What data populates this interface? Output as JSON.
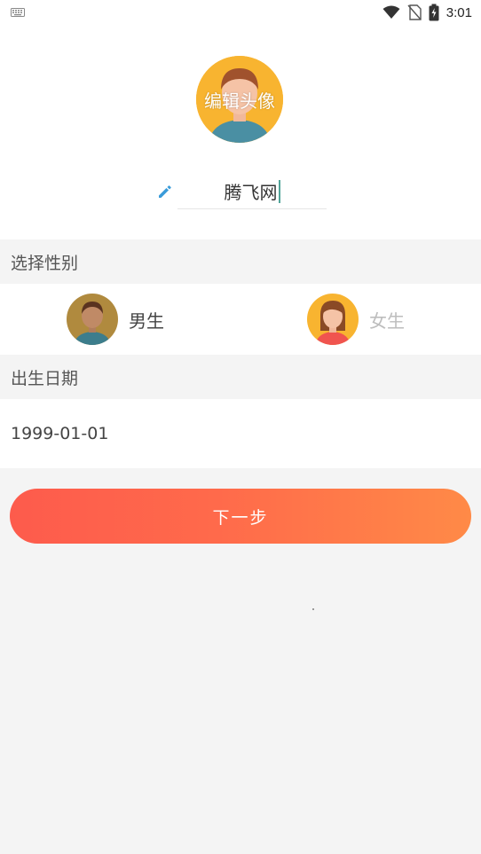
{
  "status_bar": {
    "time": "3:01",
    "icons": [
      "keyboard-icon",
      "wifi-icon",
      "no-sim-icon",
      "battery-charging-icon"
    ]
  },
  "profile": {
    "avatar_label": "编辑头像",
    "name_value": "腾飞网",
    "edit_icon": "pencil-icon"
  },
  "gender": {
    "header": "选择性别",
    "options": [
      {
        "label": "男生",
        "selected": true,
        "icon": "male-avatar-icon"
      },
      {
        "label": "女生",
        "selected": false,
        "icon": "female-avatar-icon"
      }
    ]
  },
  "birthday": {
    "header": "出生日期",
    "value": "1999-01-01"
  },
  "actions": {
    "next_label": "下一步"
  },
  "colors": {
    "accent_start": "#fd5b4c",
    "accent_end": "#ff8a47",
    "avatar_bg": "#f8b430",
    "pencil": "#3a9bd9",
    "page_bg": "#f4f4f4"
  }
}
